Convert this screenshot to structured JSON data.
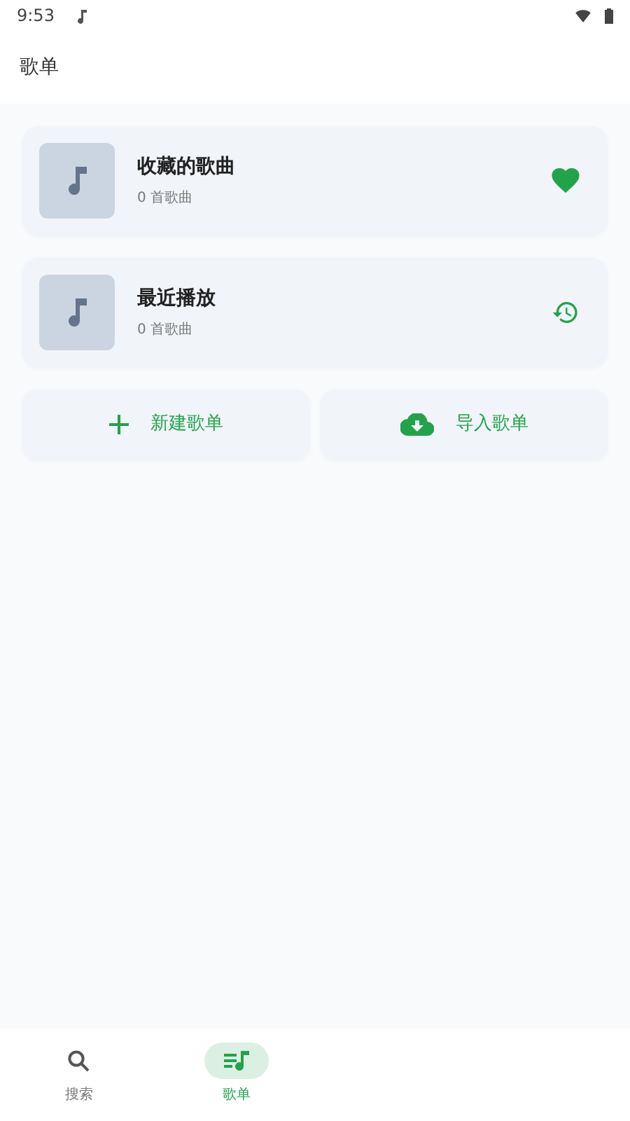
{
  "status_bar": {
    "time": "9:53"
  },
  "header": {
    "title": "歌单"
  },
  "playlists": [
    {
      "title": "收藏的歌曲",
      "count": "0 首歌曲",
      "kind": "favorite"
    },
    {
      "title": "最近播放",
      "count": "0 首歌曲",
      "kind": "history"
    }
  ],
  "actions": [
    {
      "label": "新建歌单",
      "kind": "add"
    },
    {
      "label": "导入歌单",
      "kind": "import"
    }
  ],
  "bottom_nav": [
    {
      "label": "搜索",
      "kind": "search",
      "selected": false
    },
    {
      "label": "歌单",
      "kind": "playlist",
      "selected": true
    }
  ]
}
